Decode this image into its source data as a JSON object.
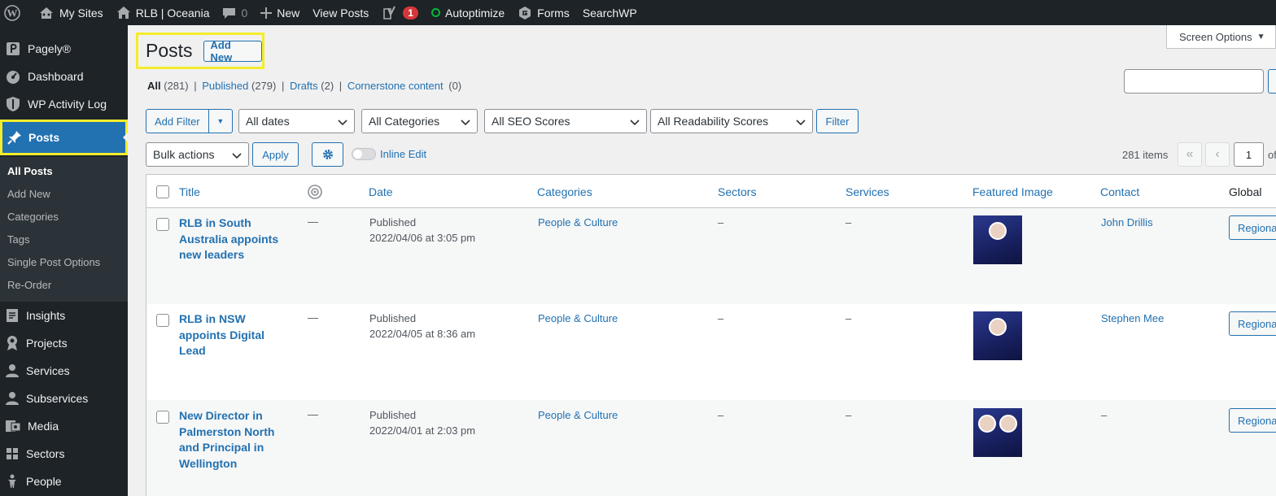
{
  "adminbar": {
    "my_sites": "My Sites",
    "site": "RLB | Oceania",
    "comments": "0",
    "new": "New",
    "view_posts": "View Posts",
    "yoast_count": "1",
    "autoptimize": "Autoptimize",
    "forms": "Forms",
    "searchwp": "SearchWP"
  },
  "sidebar": {
    "items": [
      "Pagely®",
      "Dashboard",
      "WP Activity Log",
      "Posts"
    ],
    "submenu": [
      "All Posts",
      "Add New",
      "Categories",
      "Tags",
      "Single Post Options",
      "Re-Order"
    ],
    "items2": [
      "Insights",
      "Projects",
      "Services",
      "Subservices",
      "Media",
      "Sectors",
      "People"
    ]
  },
  "screen_options": "Screen Options",
  "page": {
    "title": "Posts",
    "add_new": "Add New"
  },
  "views": {
    "all": "All",
    "all_count": "(281)",
    "published": "Published",
    "published_count": "(279)",
    "drafts": "Drafts",
    "drafts_count": "(2)",
    "cornerstone": "Cornerstone content",
    "cornerstone_count": "(0)",
    "sep": "|"
  },
  "filters": {
    "add_filter": "Add Filter",
    "dates": "All dates",
    "categories": "All Categories",
    "seo": "All SEO Scores",
    "readability": "All Readability Scores",
    "filter": "Filter"
  },
  "bulk": {
    "actions": "Bulk actions",
    "apply": "Apply",
    "inline_edit": "Inline Edit"
  },
  "pagination": {
    "items": "281 items",
    "first": "«",
    "prev": "‹",
    "current": "1",
    "of": "of"
  },
  "columns": {
    "title": "Title",
    "date": "Date",
    "categories": "Categories",
    "sectors": "Sectors",
    "services": "Services",
    "featured": "Featured Image",
    "contact": "Contact",
    "global": "Global"
  },
  "rows": [
    {
      "title": "RLB in South Australia appoints new leaders",
      "seo": "—",
      "status": "Published",
      "date": "2022/04/06 at 3:05 pm",
      "category": "People & Culture",
      "sectors": "–",
      "services": "–",
      "contact": "John Drillis",
      "global": "Regional"
    },
    {
      "title": "RLB in NSW appoints Digital Lead",
      "seo": "—",
      "status": "Published",
      "date": "2022/04/05 at 8:36 am",
      "category": "People & Culture",
      "sectors": "–",
      "services": "–",
      "contact": "Stephen Mee",
      "global": "Regional"
    },
    {
      "title": "New Director in Palmerston North and Principal in Wellington",
      "seo": "—",
      "status": "Published",
      "date": "2022/04/01 at 2:03 pm",
      "category": "People & Culture",
      "sectors": "–",
      "services": "–",
      "contact": "–",
      "global": "Regional"
    }
  ]
}
